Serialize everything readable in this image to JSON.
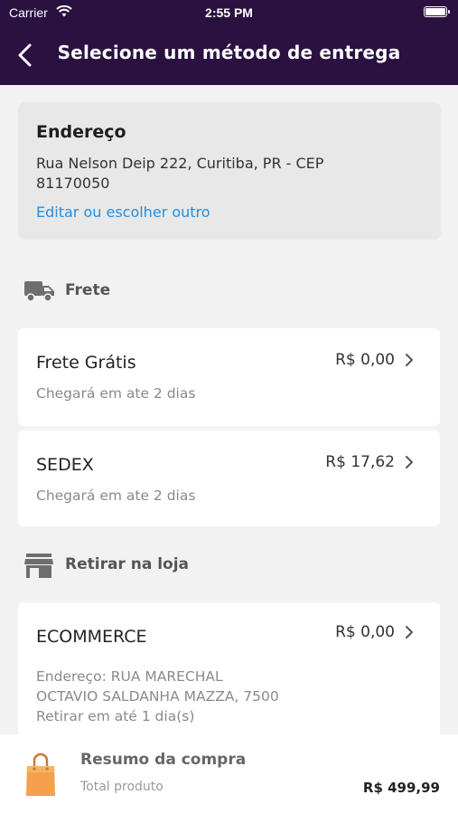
{
  "status_bar": {
    "carrier": "Carrier",
    "time": "2:55 PM"
  },
  "header": {
    "title": "Selecione um método de entrega"
  },
  "address": {
    "title": "Endereço",
    "line": "Rua Nelson Deip 222, Curitiba, PR - CEP 81170050",
    "edit_link": "Editar ou escolher outro"
  },
  "shipping_section": {
    "label": "Frete",
    "options": [
      {
        "name": "Frete Grátis",
        "subtitle": "Chegará em ate 2 dias",
        "price": "R$ 0,00"
      },
      {
        "name": "SEDEX",
        "subtitle": "Chegará em ate 2 dias",
        "price": "R$ 17,62"
      }
    ]
  },
  "pickup_section": {
    "label": "Retirar na loja",
    "options": [
      {
        "name": "ECOMMERCE",
        "address_line1": "Endereço: RUA MARECHAL",
        "address_line2": "OCTAVIO SALDANHA MAZZA, 7500",
        "pickup_time": "Retirar em até 1 dia(s)",
        "price": "R$ 0,00"
      }
    ]
  },
  "summary": {
    "title": "Resumo da compra",
    "label": "Total produto",
    "total": "R$ 499,99"
  },
  "colors": {
    "header_bg": "#2a1140",
    "link": "#1e90e6",
    "background": "#f2f2f2",
    "bag": "#f5a04a"
  }
}
